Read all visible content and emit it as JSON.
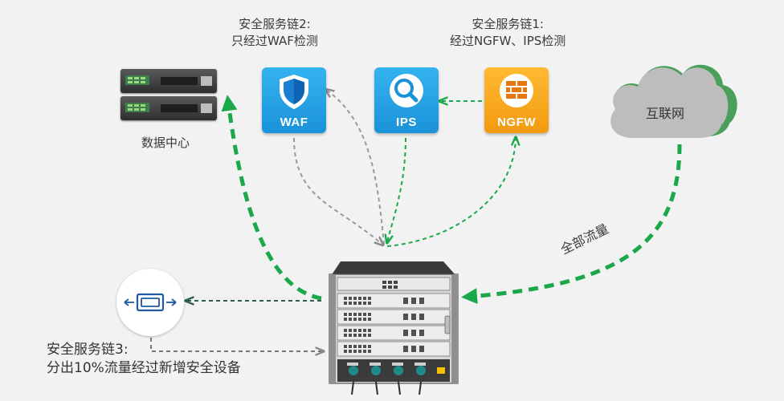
{
  "chain2": {
    "line1": "安全服务链2:",
    "line2": "只经过WAF检测"
  },
  "chain1": {
    "line1": "安全服务链1:",
    "line2": "经过NGFW、IPS检测"
  },
  "chain3": {
    "line1": "安全服务链3:",
    "line2": "分出10%流量经过新增安全设备"
  },
  "datacenter": {
    "label": "数据中心"
  },
  "internet": {
    "label": "互联网"
  },
  "traffic": {
    "label": "全部流量"
  },
  "tiles": {
    "waf": "WAF",
    "ips": "IPS",
    "ngfw": "NGFW"
  },
  "colors": {
    "background": "#f2f2f2",
    "tile_blue": "#1ea0e6",
    "tile_orange": "#f5a31a",
    "flow_green": "#1aa84a",
    "cloud_green": "#4aa05a",
    "cloud_gray": "#bdbdbd",
    "gray_path": "#9a9a9a"
  },
  "icons": [
    "server-icon",
    "shield-icon",
    "magnifier-icon",
    "firewall-icon",
    "cloud-icon",
    "security-device-icon",
    "switch-chassis-icon"
  ]
}
